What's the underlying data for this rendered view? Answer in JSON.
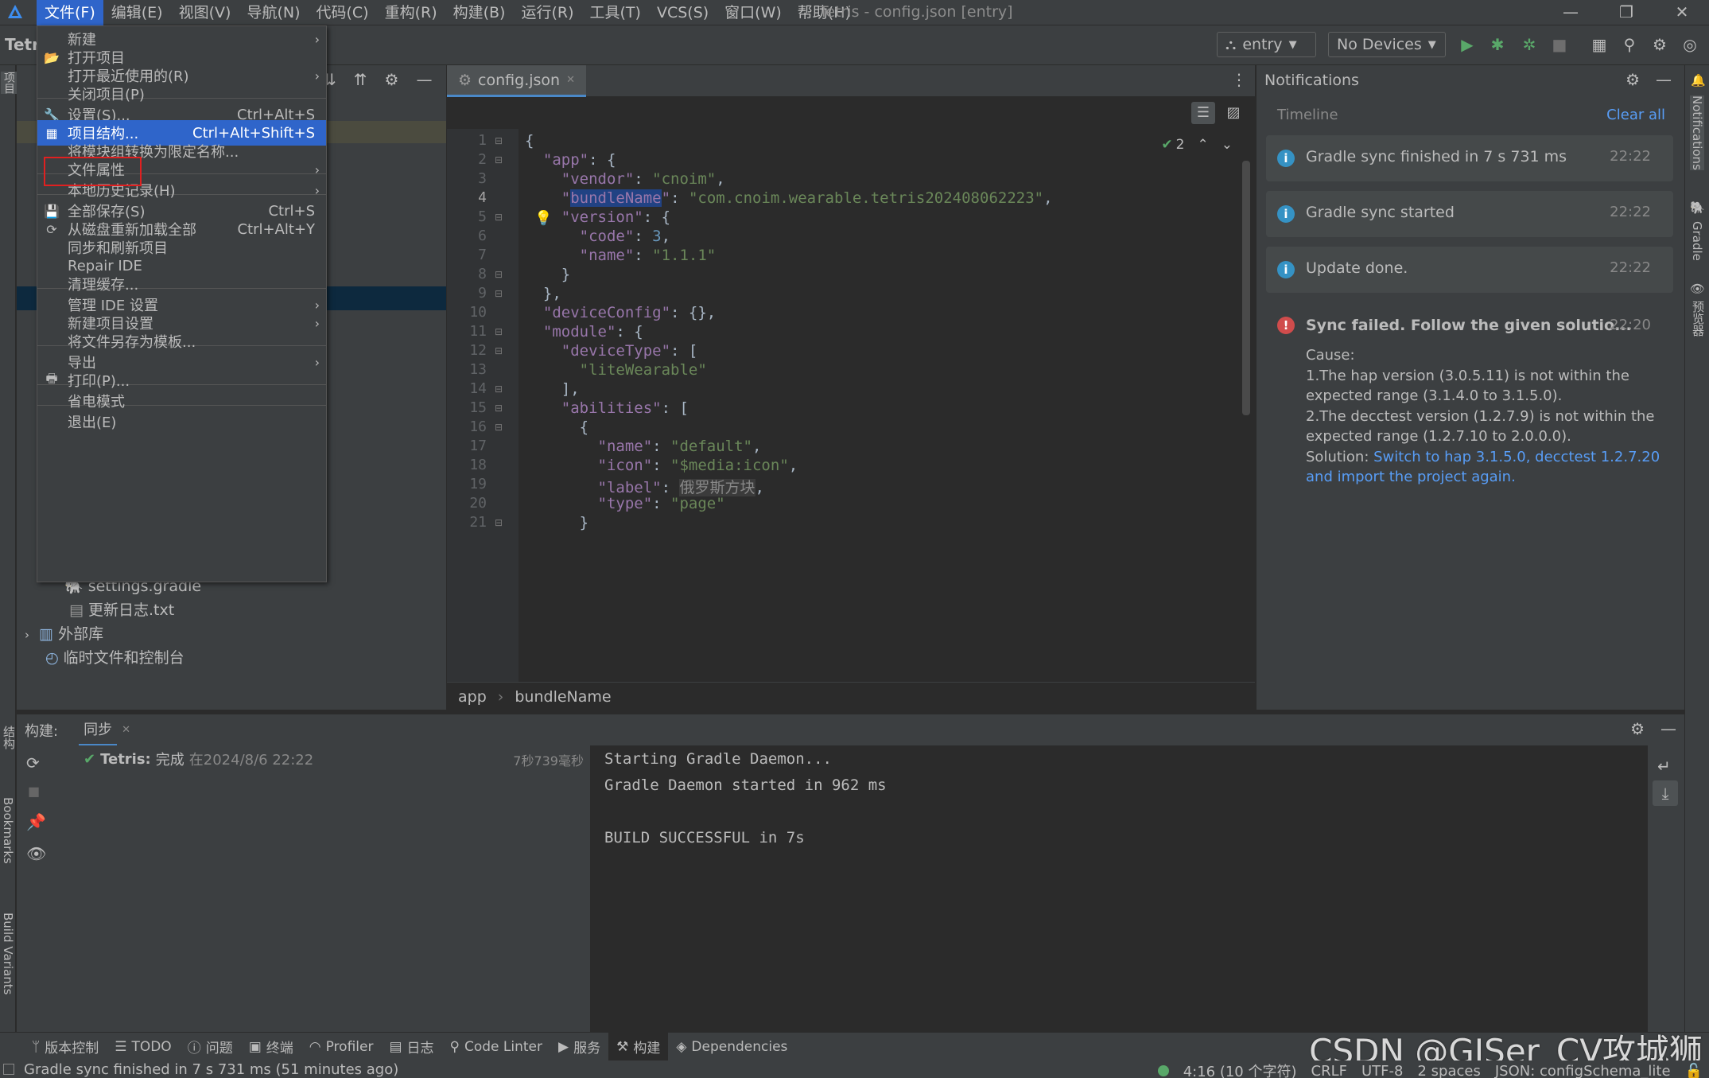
{
  "window": {
    "title": "Tetris - config.json [entry]",
    "menus": [
      "文件(F)",
      "编辑(E)",
      "视图(V)",
      "导航(N)",
      "代码(C)",
      "重构(R)",
      "构建(B)",
      "运行(R)",
      "工具(T)",
      "VCS(S)",
      "窗口(W)",
      "帮助(H)"
    ],
    "project_short": "Tetri"
  },
  "toolbar": {
    "run_config": "entry",
    "device": "No Devices"
  },
  "file_menu": {
    "items": [
      {
        "label": "新建",
        "shortcut": "",
        "submenu": true,
        "icon": ""
      },
      {
        "label": "打开项目",
        "shortcut": "",
        "submenu": false,
        "icon": "folder-icon"
      },
      {
        "label": "打开最近使用的(R)",
        "shortcut": "",
        "submenu": true,
        "icon": ""
      },
      {
        "label": "关闭项目(P)",
        "shortcut": "",
        "submenu": false,
        "icon": ""
      },
      {
        "label": "设置(S)...",
        "shortcut": "Ctrl+Alt+S",
        "submenu": false,
        "icon": "wrench-icon"
      },
      {
        "label": "项目结构...",
        "shortcut": "Ctrl+Alt+Shift+S",
        "submenu": false,
        "icon": "project-structure-icon"
      },
      {
        "label": "将模块组转换为限定名称...",
        "shortcut": "",
        "submenu": false,
        "icon": ""
      },
      {
        "label": "文件属性",
        "shortcut": "",
        "submenu": true,
        "icon": ""
      },
      {
        "label": "本地历史记录(H)",
        "shortcut": "",
        "submenu": true,
        "icon": ""
      },
      {
        "label": "全部保存(S)",
        "shortcut": "Ctrl+S",
        "submenu": false,
        "icon": "save-icon"
      },
      {
        "label": "从磁盘重新加载全部",
        "shortcut": "Ctrl+Alt+Y",
        "submenu": false,
        "icon": "reload-icon"
      },
      {
        "label": "同步和刷新项目",
        "shortcut": "",
        "submenu": false,
        "icon": ""
      },
      {
        "label": "Repair IDE",
        "shortcut": "",
        "submenu": false,
        "icon": ""
      },
      {
        "label": "清理缓存...",
        "shortcut": "",
        "submenu": false,
        "icon": ""
      },
      {
        "label": "管理 IDE 设置",
        "shortcut": "",
        "submenu": true,
        "icon": ""
      },
      {
        "label": "新建项目设置",
        "shortcut": "",
        "submenu": true,
        "icon": ""
      },
      {
        "label": "将文件另存为模板...",
        "shortcut": "",
        "submenu": false,
        "icon": ""
      },
      {
        "label": "导出",
        "shortcut": "",
        "submenu": true,
        "icon": ""
      },
      {
        "label": "打印(P)...",
        "shortcut": "",
        "submenu": false,
        "icon": "print-icon"
      },
      {
        "label": "省电模式",
        "shortcut": "",
        "submenu": false,
        "icon": ""
      },
      {
        "label": "退出(E)",
        "shortcut": "",
        "submenu": false,
        "icon": ""
      }
    ]
  },
  "project_tree": {
    "items": [
      {
        "label": "settings.gradle"
      },
      {
        "label": "更新日志.txt"
      },
      {
        "label": "外部库"
      },
      {
        "label": "临时文件和控制台"
      }
    ]
  },
  "editor": {
    "tab": "config.json",
    "check_count": "2",
    "lines": [
      "1",
      "2",
      "3",
      "4",
      "5",
      "6",
      "7",
      "8",
      "9",
      "10",
      "11",
      "12",
      "13",
      "14",
      "15",
      "16",
      "17",
      "18",
      "19",
      "20",
      "21"
    ],
    "breadcrumb": [
      "app",
      "bundleName"
    ]
  },
  "notifications": {
    "title": "Notifications",
    "timeline": "Timeline",
    "clear_all": "Clear all",
    "items": [
      {
        "message": "Gradle sync finished in 7 s 731 ms",
        "time": "22:22"
      },
      {
        "message": "Gradle sync started",
        "time": "22:22"
      },
      {
        "message": "Update done.",
        "time": "22:22"
      }
    ],
    "error": {
      "title": "Sync failed. Follow the given solutio...",
      "time": "22:20",
      "cause_label": "Cause:",
      "cause1": "1.The hap version (3.0.5.11) is not within the",
      "cause1b": "expected range (3.1.4.0 to 3.1.5.0).",
      "cause2": "2.The decctest version (1.2.7.9) is not within the",
      "cause2b": "expected range (1.2.7.10 to 2.0.0.0).",
      "solution_label": "Solution: ",
      "solution_link": "Switch to hap 3.1.5.0, decctest 1.2.7.20",
      "solution_link2": "and import the project again."
    }
  },
  "build": {
    "label": "构建:",
    "tab": "同步",
    "task_name": "Tetris:",
    "task_status": "完成",
    "task_time": "在2024/8/6 22:22",
    "duration": "7秒739毫秒",
    "output": [
      "Starting Gradle Daemon...",
      "Gradle Daemon started in 962 ms",
      "",
      "BUILD SUCCESSFUL in 7s"
    ]
  },
  "tool_windows": [
    "版本控制",
    "TODO",
    "问题",
    "终端",
    "Profiler",
    "日志",
    "Code Linter",
    "服务",
    "构建",
    "Dependencies"
  ],
  "left_stripe": [
    "项目",
    "结构",
    "Bookmarks",
    "Build Variants"
  ],
  "right_stripe": [
    "Notifications",
    "Gradle",
    "预览器"
  ],
  "status_bar": {
    "message": "Gradle sync finished in 7 s 731 ms (51 minutes ago)",
    "position": "4:16 (10 个字符)",
    "line_sep": "CRLF",
    "encoding": "UTF-8",
    "indent": "2 spaces",
    "schema": "JSON: configSchema_lite"
  },
  "watermark": "CSDN @GISer_CV攻城狮"
}
